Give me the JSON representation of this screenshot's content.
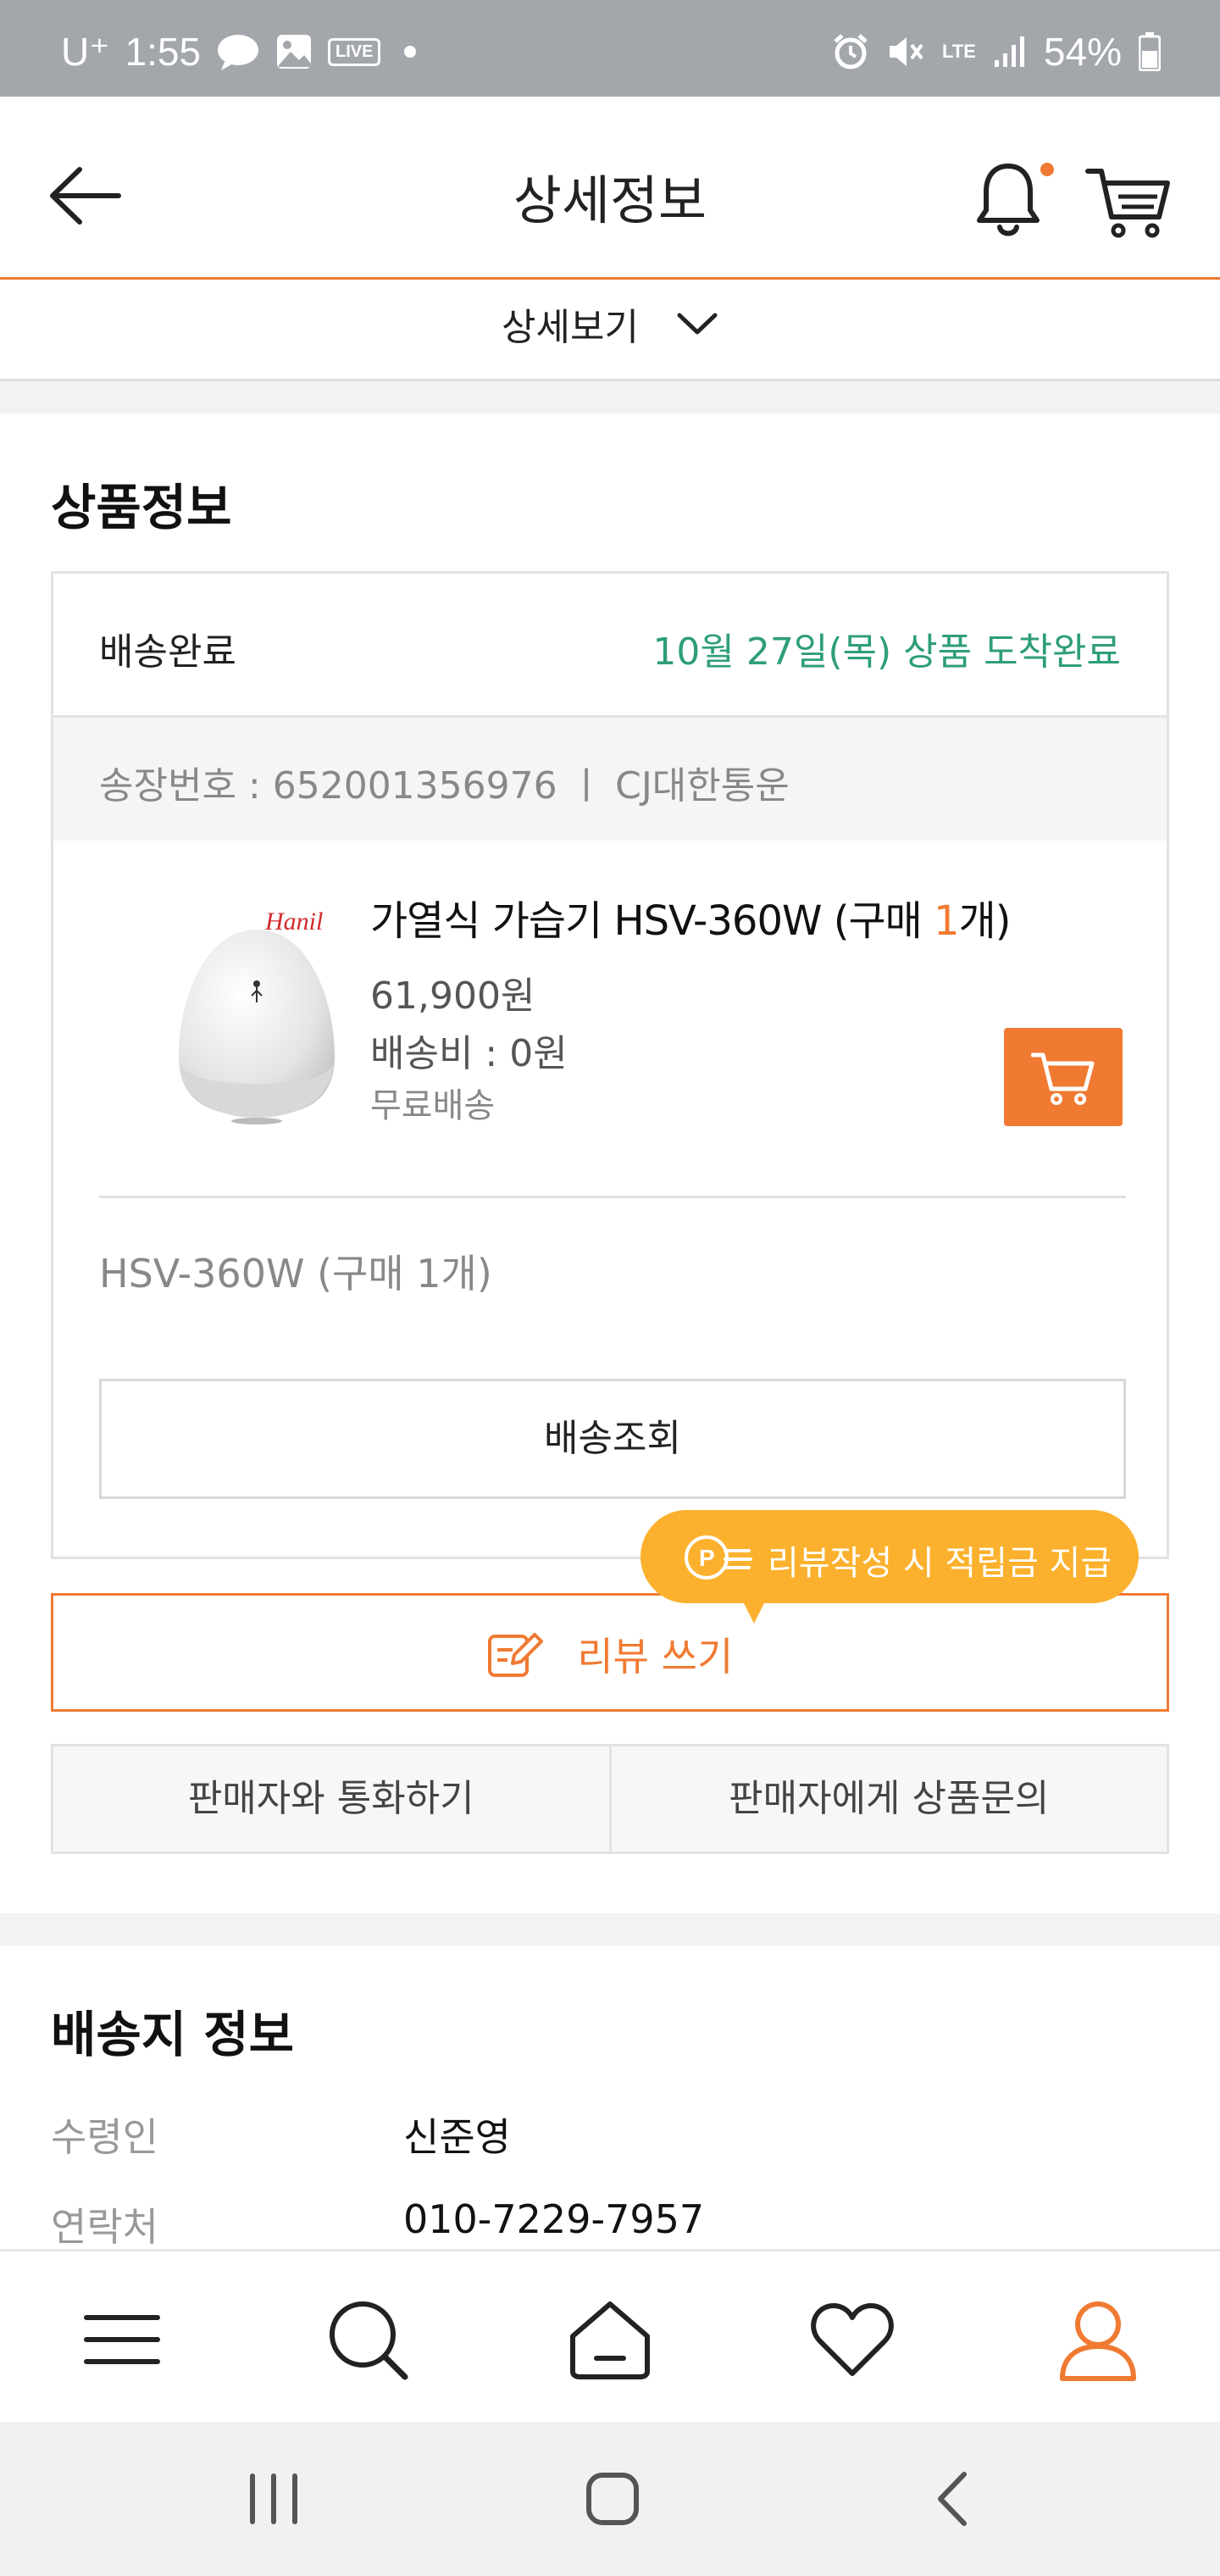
{
  "status_bar": {
    "carrier": "U⁺",
    "time": "1:55",
    "live_badge": "LIVE",
    "network": "LTE",
    "battery": "54%"
  },
  "header": {
    "title": "상세정보",
    "has_notification_dot": true,
    "accent_color": "#f07a32"
  },
  "detail_toggle": {
    "label": "상세보기"
  },
  "product_section": {
    "title": "상품정보",
    "shipping_status": "배송완료",
    "arrival_text": "10월 27일(목) 상품 도착완료",
    "tracking_text": "송장번호 : 652001356976 ㅣ CJ대한통운",
    "product": {
      "name_prefix": "가열식 가습기 HSV-360W (구매 ",
      "qty": "1",
      "name_suffix": "개)",
      "brand_logo_text": "Hanil",
      "price": "61,900원",
      "shipping_fee": "배송비 : 0원",
      "free_shipping": "무료배송"
    },
    "option_text": "HSV-360W (구매 1개)",
    "track_button": "배송조회",
    "tooltip": "리뷰작성 시 적립금 지급",
    "review_button": "리뷰 쓰기",
    "call_seller": "판매자와 통화하기",
    "ask_seller": "판매자에게 상품문의"
  },
  "delivery_section": {
    "title": "배송지 정보",
    "rows": [
      {
        "label": "수령인",
        "value": "신준영"
      },
      {
        "label": "연락처",
        "value": "010-7229-7957"
      }
    ]
  },
  "bottom_nav": {
    "items": [
      "menu-icon",
      "search-icon",
      "home-icon",
      "heart-icon",
      "user-icon"
    ],
    "active": "user-icon"
  },
  "colors": {
    "accent": "#f07a32",
    "success_green": "#2e9e78",
    "tooltip_yellow": "#fbb12d"
  }
}
